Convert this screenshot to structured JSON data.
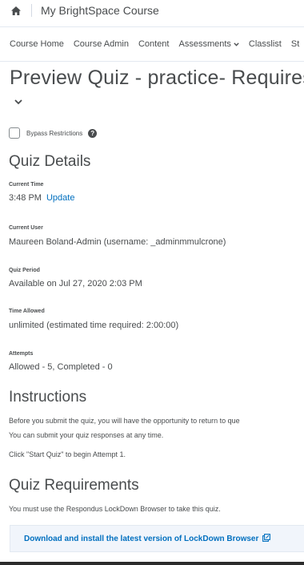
{
  "header": {
    "home_icon": "home-icon",
    "course_title": "My BrightSpace Course"
  },
  "nav": {
    "items": [
      "Course Home",
      "Course Admin",
      "Content",
      "Assessments",
      "Classlist",
      "St"
    ]
  },
  "page": {
    "title": "Preview Quiz - practice- Requires R"
  },
  "bypass": {
    "label": "Bypass Restrictions",
    "checked": false,
    "help_icon": "question-circle-icon",
    "help_glyph": "?"
  },
  "quiz_details": {
    "heading": "Quiz Details",
    "current_time_label": "Current Time",
    "current_time_value": "3:48 PM",
    "update_link": "Update",
    "current_user_label": "Current User",
    "current_user_value": "Maureen Boland-Admin (username: _adminmmulcrone)",
    "quiz_period_label": "Quiz Period",
    "quiz_period_value": "Available on Jul 27, 2020 2:03 PM",
    "time_allowed_label": "Time Allowed",
    "time_allowed_value": "unlimited (estimated time required: 2:00:00)",
    "attempts_label": "Attempts",
    "attempts_value": "Allowed - 5, Completed - 0"
  },
  "instructions": {
    "heading": "Instructions",
    "line1": "Before you submit the quiz, you will have the opportunity to return to que",
    "line2": "You can submit your quiz responses at any time.",
    "line3": "Click \"Start Quiz\" to begin Attempt 1."
  },
  "requirements": {
    "heading": "Quiz Requirements",
    "text": "You must use the Respondus LockDown Browser to take this quiz.",
    "download_link": "Download and install the latest version of LockDown Browser",
    "external_icon": "external-link-icon"
  },
  "colors": {
    "link": "#006fbf",
    "text": "#494c4e",
    "panel_bg": "#f1f5fb"
  }
}
